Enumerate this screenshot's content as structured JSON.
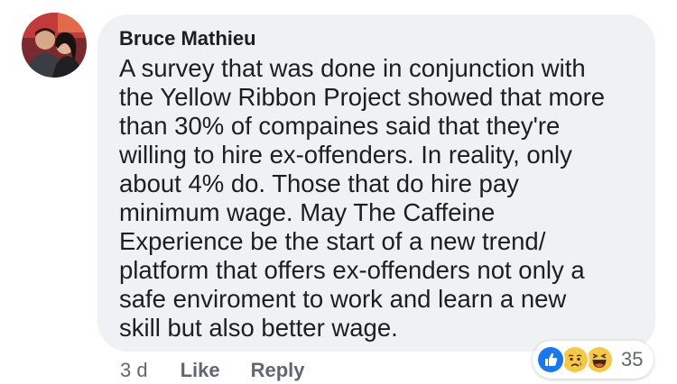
{
  "comment": {
    "author": "Bruce Mathieu",
    "lines": [
      "A survey that was done in conjunction with",
      "the Yellow Ribbon Project showed that more",
      "than 30% of compaines said that they're",
      "willing to hire ex-offenders. In reality, only",
      "about 4% do. Those that do hire pay",
      "minimum wage. May The Caffeine",
      "Experience be the start of a new trend/",
      "platform that offers ex-offenders not only a",
      "safe enviroment to work and learn a new",
      "skill but also better wage."
    ],
    "timestamp": "3 d",
    "like_label": "Like",
    "reply_label": "Reply"
  },
  "reactions": {
    "icons": [
      "like-icon",
      "sad-icon",
      "haha-icon"
    ],
    "count": "35"
  },
  "colors": {
    "bubble": "#f0f1f4",
    "like_blue": "#1877f2",
    "reaction_yellow": "#f7c844",
    "text": "#1c1e21",
    "secondary": "#606770"
  }
}
